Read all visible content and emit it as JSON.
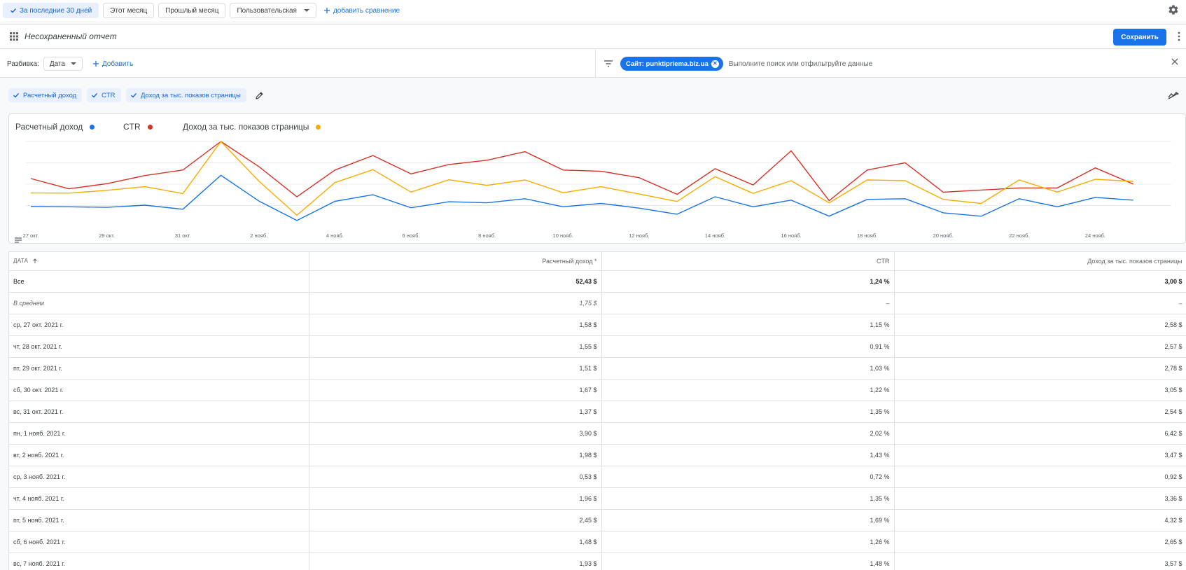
{
  "date_presets": [
    {
      "label": "За последние 30 дней",
      "active": true
    },
    {
      "label": "Этот месяц",
      "active": false
    },
    {
      "label": "Прошлый месяц",
      "active": false
    },
    {
      "label": "Пользовательская",
      "active": false,
      "dropdown": true
    }
  ],
  "add_comparison": "добавить сравнение",
  "report": {
    "title": "Несохраненный отчет",
    "save_label": "Сохранить"
  },
  "breakdown": {
    "label": "Разбивка:",
    "dimension": "Дата",
    "add_label": "Добавить"
  },
  "filter": {
    "chip_label": "Сайт: punktipriema.biz.ua",
    "search_placeholder": "Выполните поиск или отфильтруйте данные"
  },
  "metrics": [
    {
      "label": "Расчетный доход",
      "color": "#1a73e8"
    },
    {
      "label": "CTR",
      "color": "#d93025"
    },
    {
      "label": "Доход за тыс. показов страницы",
      "color": "#f9ab00"
    }
  ],
  "chart_data": {
    "type": "line",
    "x": [
      "27 окт.",
      "28 окт.",
      "29 окт.",
      "30 окт.",
      "31 окт.",
      "1 нояб.",
      "2 нояб.",
      "3 нояб.",
      "4 нояб.",
      "5 нояб.",
      "6 нояб.",
      "7 нояб.",
      "8 нояб.",
      "9 нояб.",
      "10 нояб.",
      "11 нояб.",
      "12 нояб.",
      "13 нояб.",
      "14 нояб.",
      "15 нояб.",
      "16 нояб.",
      "17 нояб.",
      "18 нояб.",
      "19 нояб.",
      "20 нояб.",
      "21 нояб.",
      "22 нояб.",
      "23 нояб.",
      "24 нояб.",
      "25 нояб."
    ],
    "x_tick_labels": [
      "27 окт.",
      "29 окт.",
      "31 окт.",
      "2 нояб.",
      "4 нояб.",
      "6 нояб.",
      "8 нояб.",
      "10 нояб.",
      "12 нояб.",
      "14 нояб.",
      "16 нояб.",
      "18 нояб.",
      "20 нояб.",
      "22 нояб.",
      "24 нояб."
    ],
    "axes": {
      "revenue_ylim": [
        0,
        7
      ],
      "ctr_ylim": [
        0,
        2.2
      ]
    },
    "grid": true,
    "legend": "top-left",
    "series": [
      {
        "name": "Расчетный доход",
        "color": "#1a73e8",
        "axis": "revenue",
        "values": [
          1.58,
          1.55,
          1.51,
          1.67,
          1.37,
          3.9,
          1.98,
          0.53,
          1.96,
          2.45,
          1.48,
          1.93,
          1.85,
          2.15,
          1.55,
          1.8,
          1.45,
          1.0,
          2.3,
          1.55,
          2.05,
          0.85,
          2.1,
          2.15,
          1.1,
          0.85,
          2.15,
          1.55,
          2.25,
          2.05
        ]
      },
      {
        "name": "CTR",
        "color": "#d93025",
        "axis": "ctr",
        "values": [
          1.15,
          0.91,
          1.03,
          1.22,
          1.35,
          2.02,
          1.43,
          0.72,
          1.35,
          1.69,
          1.26,
          1.48,
          1.58,
          1.78,
          1.35,
          1.32,
          1.17,
          0.78,
          1.38,
          1.0,
          1.8,
          0.63,
          1.35,
          1.52,
          0.83,
          0.88,
          0.93,
          0.93,
          1.4,
          1.02
        ]
      },
      {
        "name": "Доход за тыс. показов страницы",
        "color": "#f9ab00",
        "axis": "revenue",
        "values": [
          2.58,
          2.57,
          2.78,
          3.05,
          2.54,
          6.42,
          3.47,
          0.92,
          3.36,
          4.32,
          2.65,
          3.57,
          3.15,
          3.55,
          2.6,
          3.05,
          2.5,
          1.95,
          3.8,
          2.55,
          3.5,
          1.85,
          3.55,
          3.5,
          2.1,
          1.8,
          3.55,
          2.65,
          3.6,
          3.45
        ]
      }
    ]
  },
  "table": {
    "columns": [
      "Дата",
      "Расчетный доход *",
      "CTR",
      "Доход за тыс. показов страницы"
    ],
    "total": {
      "label": "Все",
      "revenue": "52,43 $",
      "ctr": "1,24 %",
      "rpm": "3,00 $"
    },
    "average": {
      "label": "В среднем",
      "revenue": "1,75 $",
      "ctr": "–",
      "rpm": "–"
    },
    "rows": [
      {
        "date": "ср, 27 окт. 2021 г.",
        "revenue": "1,58 $",
        "ctr": "1,15 %",
        "rpm": "2,58 $"
      },
      {
        "date": "чт, 28 окт. 2021 г.",
        "revenue": "1,55 $",
        "ctr": "0,91 %",
        "rpm": "2,57 $"
      },
      {
        "date": "пт, 29 окт. 2021 г.",
        "revenue": "1,51 $",
        "ctr": "1,03 %",
        "rpm": "2,78 $"
      },
      {
        "date": "сб, 30 окт. 2021 г.",
        "revenue": "1,67 $",
        "ctr": "1,22 %",
        "rpm": "3,05 $"
      },
      {
        "date": "вс, 31 окт. 2021 г.",
        "revenue": "1,37 $",
        "ctr": "1,35 %",
        "rpm": "2,54 $"
      },
      {
        "date": "пн, 1 нояб. 2021 г.",
        "revenue": "3,90 $",
        "ctr": "2,02 %",
        "rpm": "6,42 $"
      },
      {
        "date": "вт, 2 нояб. 2021 г.",
        "revenue": "1,98 $",
        "ctr": "1,43 %",
        "rpm": "3,47 $"
      },
      {
        "date": "ср, 3 нояб. 2021 г.",
        "revenue": "0,53 $",
        "ctr": "0,72 %",
        "rpm": "0,92 $"
      },
      {
        "date": "чт, 4 нояб. 2021 г.",
        "revenue": "1,96 $",
        "ctr": "1,35 %",
        "rpm": "3,36 $"
      },
      {
        "date": "пт, 5 нояб. 2021 г.",
        "revenue": "2,45 $",
        "ctr": "1,69 %",
        "rpm": "4,32 $"
      },
      {
        "date": "сб, 6 нояб. 2021 г.",
        "revenue": "1,48 $",
        "ctr": "1,26 %",
        "rpm": "2,65 $"
      },
      {
        "date": "вс, 7 нояб. 2021 г.",
        "revenue": "1,93 $",
        "ctr": "1,48 %",
        "rpm": "3,57 $"
      }
    ]
  }
}
